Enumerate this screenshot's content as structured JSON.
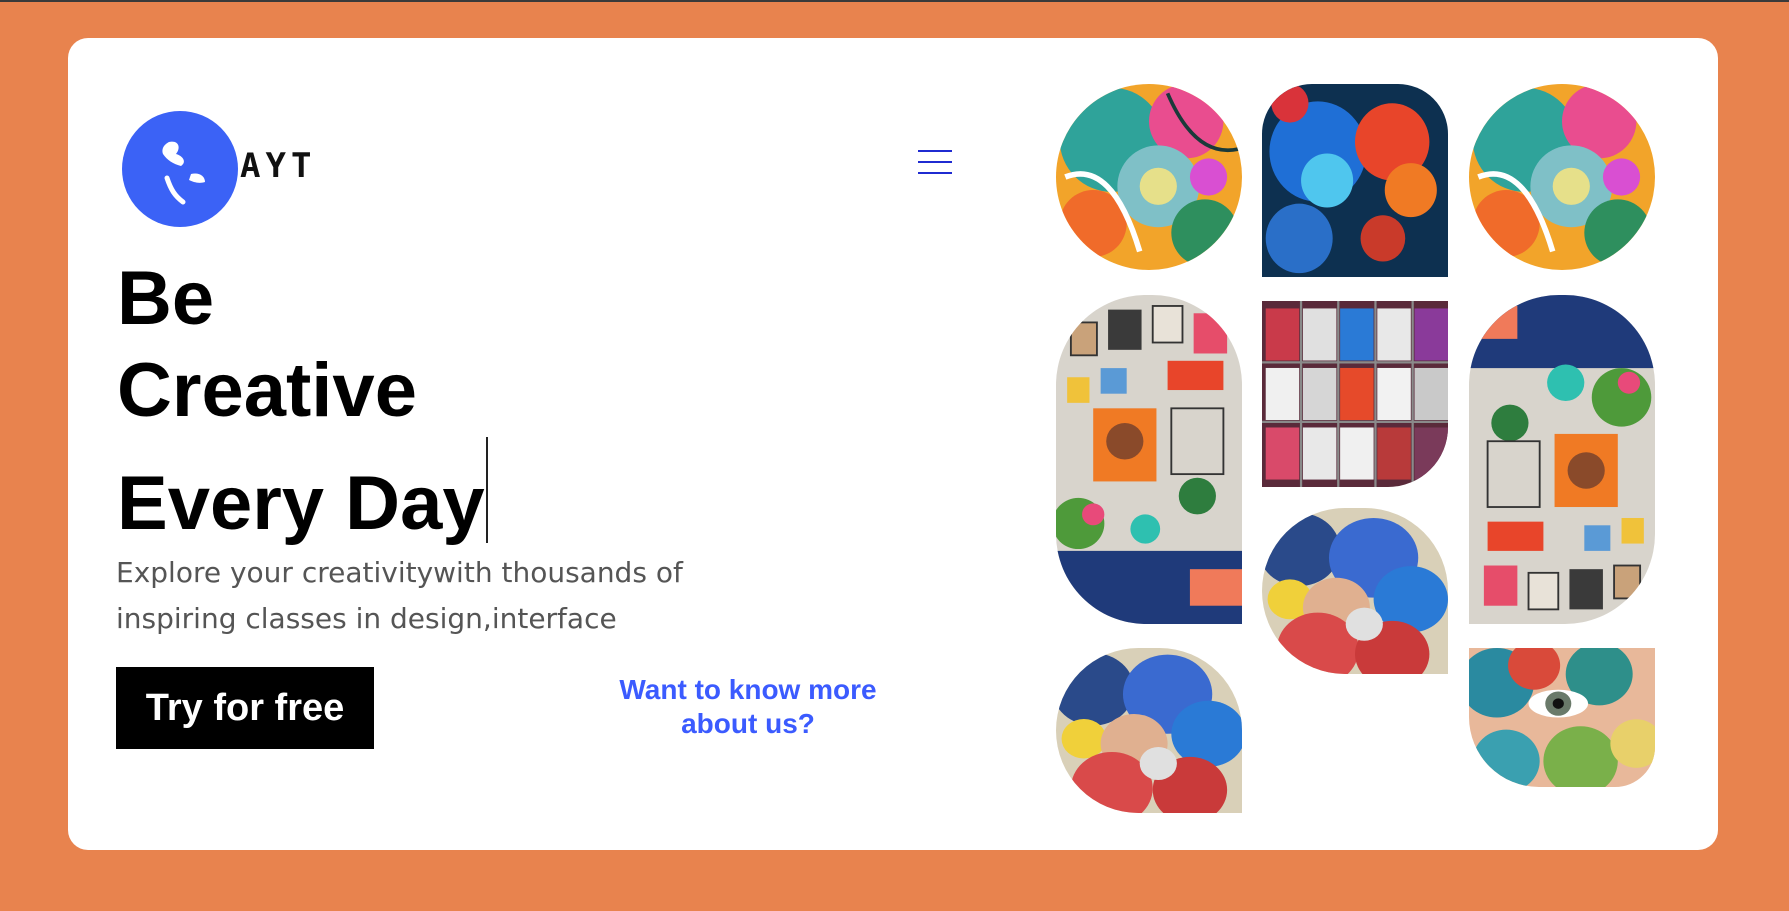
{
  "brand": {
    "name": "AYT"
  },
  "hero": {
    "line1": "Be",
    "line2": "Creative",
    "line3": "Every Day",
    "subtitle": "Explore your creativitywith thousands of inspiring classes in design,interface"
  },
  "actions": {
    "try_label": "Try for free",
    "more_label": "Want to know more about us?"
  },
  "colors": {
    "background": "#e8834e",
    "card": "#ffffff",
    "logo": "#3b62f6",
    "link": "#3b5bff",
    "menu": "#1f2bd1",
    "button": "#000000"
  },
  "icons": [
    "logo-icon",
    "menu-icon"
  ],
  "gallery": [
    "marbled-paint-image",
    "ink-smoke-image",
    "marbled-paint-image",
    "gallery-wall-image",
    "spray-cans-image",
    "oil-paint-image",
    "gallery-wall-image",
    "oil-paint-image",
    "painted-face-image"
  ]
}
